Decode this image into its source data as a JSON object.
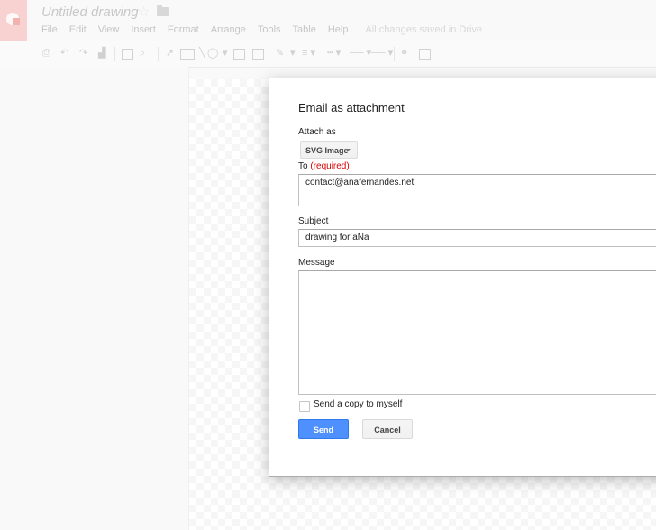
{
  "app": {
    "doc_title": "Untitled drawing",
    "menu": [
      "File",
      "Edit",
      "View",
      "Insert",
      "Format",
      "Arrange",
      "Tools",
      "Table",
      "Help"
    ],
    "save_status": "All changes saved in Drive"
  },
  "toolbar": {
    "icons": [
      "print-icon",
      "undo-icon",
      "redo-icon",
      "paint-format-icon",
      "zoom-fit-icon",
      "zoom-icon",
      "select-icon",
      "word-art-icon",
      "shape-icon",
      "text-box-icon",
      "image-icon",
      "line-color-icon",
      "line-weight-icon",
      "line-dash-icon",
      "line-start-icon",
      "line-end-icon",
      "link-icon",
      "comment-icon"
    ]
  },
  "dialog": {
    "title": "Email as attachment",
    "attach_label": "Attach as",
    "attach_value": "SVG Image",
    "to_label": "To",
    "to_required": "(required)",
    "to_value": "contact@anafernandes.net",
    "subject_label": "Subject",
    "subject_value": "drawing for aNa",
    "message_label": "Message",
    "message_value": "",
    "copy_label": "Send a copy to myself",
    "copy_checked": false,
    "send_label": "Send",
    "cancel_label": "Cancel"
  },
  "colors": {
    "primary_button": "#4d90fe",
    "required": "#dd0000",
    "app_accent": "#f7d2d0"
  }
}
